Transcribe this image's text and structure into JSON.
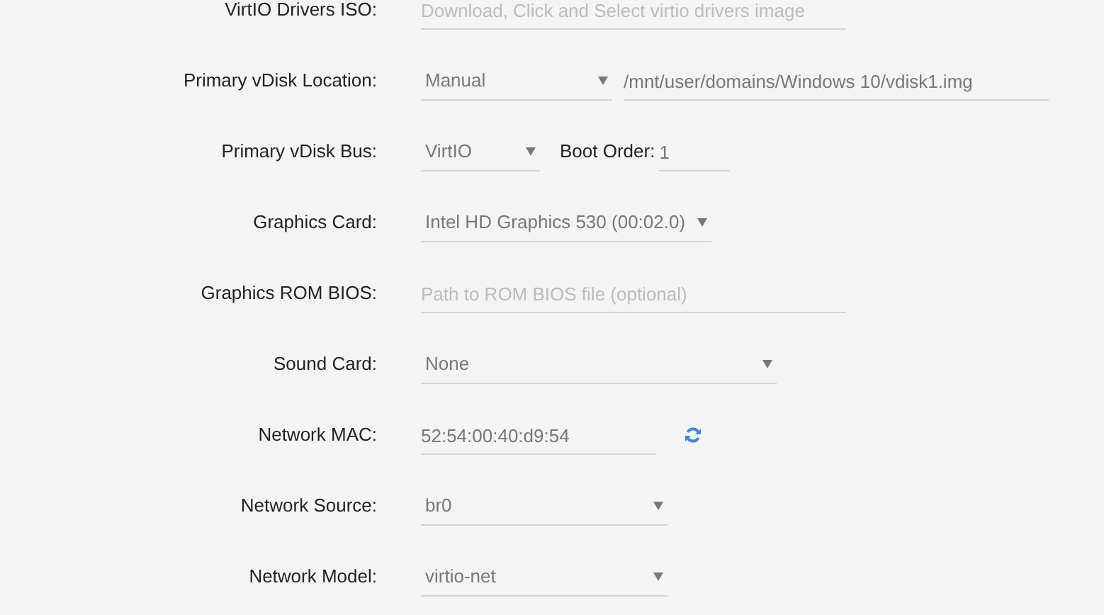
{
  "rows": [
    {
      "label": "VirtIO Drivers ISO:",
      "controls": [
        {
          "kind": "text",
          "placeholder": "Download, Click and Select virtio drivers image"
        }
      ]
    },
    {
      "label": "Primary vDisk Location:",
      "controls": [
        {
          "kind": "select",
          "value": "Manual"
        },
        {
          "kind": "text",
          "value": "/mnt/user/domains/Windows 10/vdisk1.img"
        }
      ]
    },
    {
      "label": "Primary vDisk Bus:",
      "controls": [
        {
          "kind": "select",
          "value": "VirtIO"
        },
        {
          "kind": "label",
          "text": "Boot Order:"
        },
        {
          "kind": "text",
          "value": "1"
        }
      ]
    },
    {
      "label": "Graphics Card:",
      "controls": [
        {
          "kind": "select",
          "value": "Intel HD Graphics 530 (00:02.0)"
        }
      ]
    },
    {
      "label": "Graphics ROM BIOS:",
      "controls": [
        {
          "kind": "text",
          "placeholder": "Path to ROM BIOS file (optional)"
        }
      ]
    },
    {
      "label": "Sound Card:",
      "controls": [
        {
          "kind": "select",
          "value": "None"
        }
      ]
    },
    {
      "label": "Network MAC:",
      "controls": [
        {
          "kind": "text",
          "value": "52:54:00:40:d9:54"
        },
        {
          "kind": "refresh"
        }
      ]
    },
    {
      "label": "Network Source:",
      "controls": [
        {
          "kind": "select",
          "value": "br0"
        }
      ]
    },
    {
      "label": "Network Model:",
      "controls": [
        {
          "kind": "select",
          "value": "virtio-net"
        }
      ]
    }
  ]
}
